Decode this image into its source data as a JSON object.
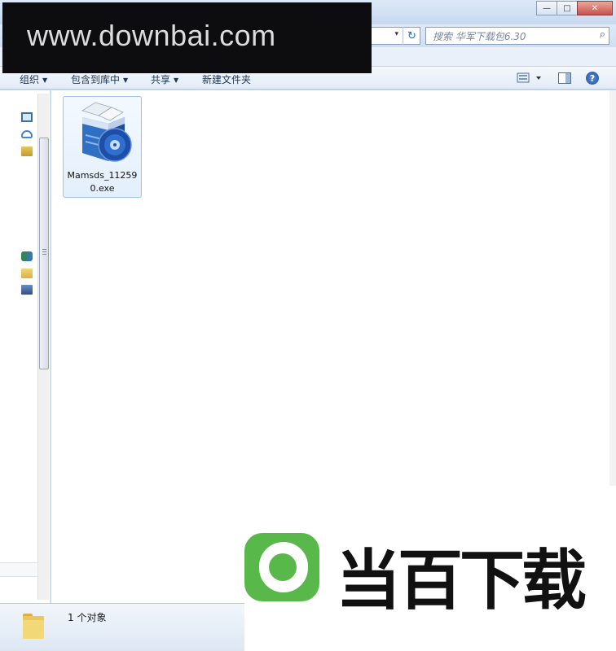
{
  "window": {
    "controls": {
      "minimize": "—",
      "maximize": "□",
      "close": "✕"
    }
  },
  "navbar": {
    "address_dropdown": "▾",
    "search_placeholder": "搜索 华军下载包6.30"
  },
  "toolbar": {
    "organize": "组织",
    "include_in_library": "包含到库中",
    "share": "共享",
    "new_folder": "新建文件夹",
    "help": "?"
  },
  "icons": {
    "refresh": "refresh-icon",
    "search": "search-icon",
    "view": "view-options-icon",
    "preview_pane": "preview-pane-icon",
    "help": "help-icon"
  },
  "files": [
    {
      "name": "Mamsds_11259\n0.exe",
      "icon": "installer-box-icon"
    }
  ],
  "statusbar": {
    "item_count": "1 个对象"
  },
  "watermarks": {
    "url": "www.downbai.com",
    "logo_text": "当百下载"
  },
  "colors": {
    "logo_green": "#58b94a",
    "selection_border": "#9ec3e8",
    "toolbar_text": "#1e3450"
  }
}
